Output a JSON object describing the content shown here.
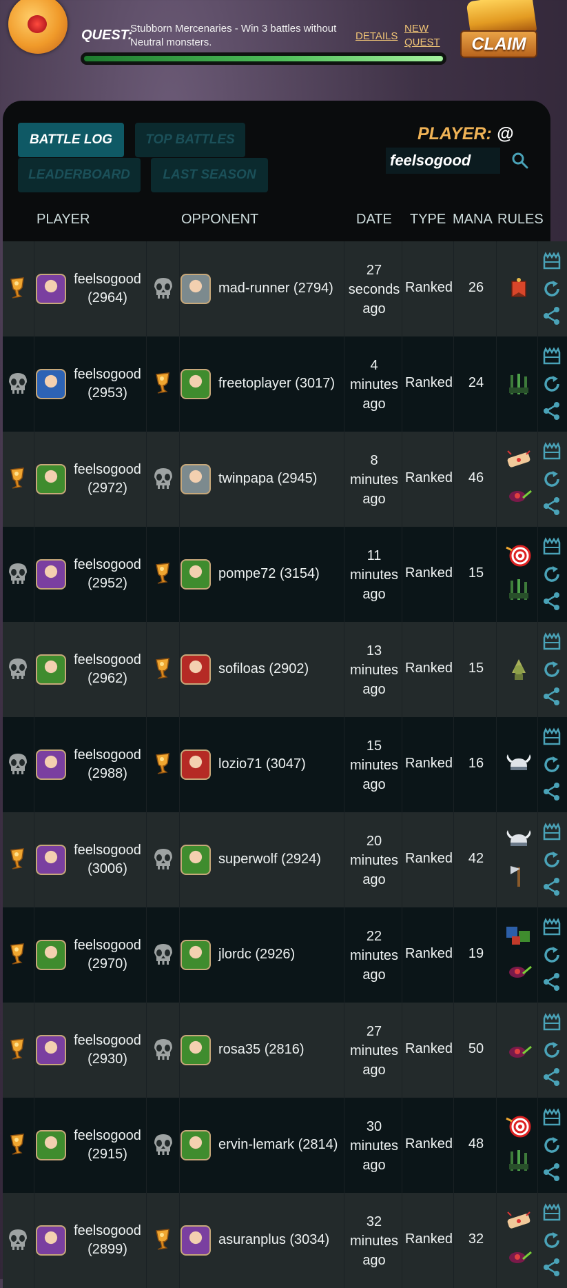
{
  "quest": {
    "label": "QUEST:",
    "text": "Stubborn Mercenaries - Win 3 battles without Neutral monsters.",
    "details_label": "DETAILS",
    "new_quest_label": "NEW QUEST",
    "progress": 1.0,
    "claim_label": "CLAIM"
  },
  "tabs": {
    "battle_log": "BATTLE LOG",
    "top_battles": "TOP BATTLES",
    "leaderboard": "LEADERBOARD",
    "last_season": "LAST SEASON"
  },
  "search": {
    "label": "PLAYER:",
    "at": " @",
    "value": "feelsogood"
  },
  "columns": {
    "player": "PLAYER",
    "opponent": "OPPONENT",
    "date": "DATE",
    "type": "TYPE",
    "mana": "MANA",
    "rules": "RULES"
  },
  "colors": {
    "active_tab": "#0f5965",
    "inactive_tab": "#0b2a2e",
    "accent_gold": "#f0b356",
    "action_icon": "#4aa3b8"
  },
  "rows": [
    {
      "player_result": "win",
      "player_avatar": "purple",
      "player_name": "feelsogood",
      "player_rating": "(2964)",
      "opp_result": "loss",
      "opp_avatar": "grey",
      "opponent": "mad-runner (2794)",
      "date_num": "27",
      "date_unit": "seconds",
      "date_ago": "ago",
      "type": "Ranked",
      "mana": "26",
      "rules": [
        "flag-icon"
      ]
    },
    {
      "player_result": "loss",
      "player_avatar": "blue",
      "player_name": "feelsogood",
      "player_rating": "(2953)",
      "opp_result": "win",
      "opp_avatar": "green",
      "opponent": "freetoplayer (3017)",
      "date_num": "4",
      "date_unit": "minutes",
      "date_ago": "ago",
      "type": "Ranked",
      "mana": "24",
      "rules": [
        "spikes-icon"
      ]
    },
    {
      "player_result": "win",
      "player_avatar": "green",
      "player_name": "feelsogood",
      "player_rating": "(2972)",
      "opp_result": "loss",
      "opp_avatar": "grey",
      "opponent": "twinpapa (2945)",
      "date_num": "8",
      "date_unit": "minutes",
      "date_ago": "ago",
      "type": "Ranked",
      "mana": "46",
      "rules": [
        "bandage-icon",
        "snail-icon"
      ]
    },
    {
      "player_result": "loss",
      "player_avatar": "purple",
      "player_name": "feelsogood",
      "player_rating": "(2952)",
      "opp_result": "win",
      "opp_avatar": "green",
      "opponent": "pompe72 (3154)",
      "date_num": "11",
      "date_unit": "minutes",
      "date_ago": "ago",
      "type": "Ranked",
      "mana": "15",
      "rules": [
        "target-icon",
        "spikes-icon"
      ]
    },
    {
      "player_result": "loss",
      "player_avatar": "green",
      "player_name": "feelsogood",
      "player_rating": "(2962)",
      "opp_result": "win",
      "opp_avatar": "red",
      "opponent": "sofiloas (2902)",
      "date_num": "13",
      "date_unit": "minutes",
      "date_ago": "ago",
      "type": "Ranked",
      "mana": "15",
      "rules": [
        "goblin-icon"
      ]
    },
    {
      "player_result": "loss",
      "player_avatar": "purple",
      "player_name": "feelsogood",
      "player_rating": "(2988)",
      "opp_result": "win",
      "opp_avatar": "red",
      "opponent": "lozio71 (3047)",
      "date_num": "15",
      "date_unit": "minutes",
      "date_ago": "ago",
      "type": "Ranked",
      "mana": "16",
      "rules": [
        "viking-helmet-icon"
      ]
    },
    {
      "player_result": "win",
      "player_avatar": "purple",
      "player_name": "feelsogood",
      "player_rating": "(3006)",
      "opp_result": "loss",
      "opp_avatar": "green",
      "opponent": "superwolf (2924)",
      "date_num": "20",
      "date_unit": "minutes",
      "date_ago": "ago",
      "type": "Ranked",
      "mana": "42",
      "rules": [
        "viking-helmet-icon",
        "axe-icon"
      ]
    },
    {
      "player_result": "win",
      "player_avatar": "green",
      "player_name": "feelsogood",
      "player_rating": "(2970)",
      "opp_result": "loss",
      "opp_avatar": "green",
      "opponent": "jlordc (2926)",
      "date_num": "22",
      "date_unit": "minutes",
      "date_ago": "ago",
      "type": "Ranked",
      "mana": "19",
      "rules": [
        "sn-blocks-icon",
        "snail-icon"
      ]
    },
    {
      "player_result": "win",
      "player_avatar": "purple",
      "player_name": "feelsogood",
      "player_rating": "(2930)",
      "opp_result": "loss",
      "opp_avatar": "green",
      "opponent": "rosa35 (2816)",
      "date_num": "27",
      "date_unit": "minutes",
      "date_ago": "ago",
      "type": "Ranked",
      "mana": "50",
      "rules": [
        "snail-icon"
      ]
    },
    {
      "player_result": "win",
      "player_avatar": "green",
      "player_name": "feelsogood",
      "player_rating": "(2915)",
      "opp_result": "loss",
      "opp_avatar": "green",
      "opponent": "ervin-lemark (2814)",
      "date_num": "30",
      "date_unit": "minutes",
      "date_ago": "ago",
      "type": "Ranked",
      "mana": "48",
      "rules": [
        "target-icon",
        "spikes-icon"
      ]
    },
    {
      "player_result": "loss",
      "player_avatar": "purple",
      "player_name": "feelsogood",
      "player_rating": "(2899)",
      "opp_result": "win",
      "opp_avatar": "purple",
      "opponent": "asuranplus (3034)",
      "date_num": "32",
      "date_unit": "minutes",
      "date_ago": "ago",
      "type": "Ranked",
      "mana": "32",
      "rules": [
        "bandage-icon",
        "snail-icon"
      ]
    }
  ]
}
